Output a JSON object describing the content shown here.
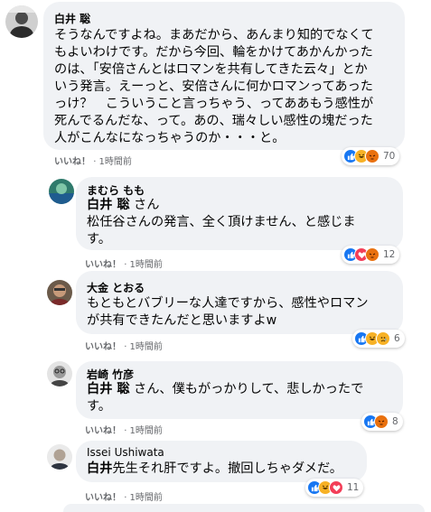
{
  "comments": [
    {
      "author": "白井 聡",
      "lines": [
        "そうなんですよね。まあだから、あんまり知的でなくて",
        "もよいわけです。だから今回、輪をかけてあかんかった",
        "のは、「安倍さんとはロマンを共有してきた云々」とか",
        "いう発言。えーっと、安倍さんに何かロマンってあった",
        "っけ？　こういうこと言っちゃう、ってああもう感性が",
        "死んでるんだな、って。あの、瑞々しい感性の塊だった",
        "人がこんなになっちゃうのか・・・と。"
      ],
      "like_label": "いいね！",
      "time": "1時間前",
      "reaction_count": "70",
      "reactions": [
        "like-icon",
        "haha-icon",
        "angry-icon"
      ]
    },
    {
      "author": "まむら もも",
      "mention": "白井 聡",
      "lines": [
        " さん",
        "松任谷さんの発言、全く頂けません、と感じま",
        "す。"
      ],
      "like_label": "いいね！",
      "time": "1時間前",
      "reaction_count": "12",
      "reactions": [
        "like-icon",
        "love-icon",
        "angry-icon"
      ]
    },
    {
      "author": "大金 とおる",
      "lines": [
        "もともとバブリーな人達ですから、感性やロマン",
        "が共有できたんだと思いますよw"
      ],
      "like_label": "いいね！",
      "time": "1時間前",
      "reaction_count": "6",
      "reactions": [
        "like-icon",
        "haha-icon",
        "sad-icon"
      ]
    },
    {
      "author": "岩崎 竹彦",
      "mention": "白井 聡",
      "lines": [
        " さん、僕もがっかりして、悲しかったで",
        "す。"
      ],
      "like_label": "いいね！",
      "time": "1時間前",
      "reaction_count": "8",
      "reactions": [
        "like-icon",
        "angry-icon"
      ]
    },
    {
      "author": "Issei Ushiwata",
      "mention": "白井",
      "lines": [
        "先生それ肝ですよ。撤回しちゃダメだ。"
      ],
      "like_label": "いいね！",
      "time": "1時間前",
      "reaction_count": "11",
      "reactions": [
        "like-icon",
        "haha-icon",
        "love-icon"
      ]
    }
  ],
  "colors": {
    "bubble": "#f0f2f5",
    "meta_text": "#65676b",
    "like": "#1877f2",
    "haha": "#f7b125",
    "angry": "#e9710f",
    "love": "#f33e58"
  }
}
